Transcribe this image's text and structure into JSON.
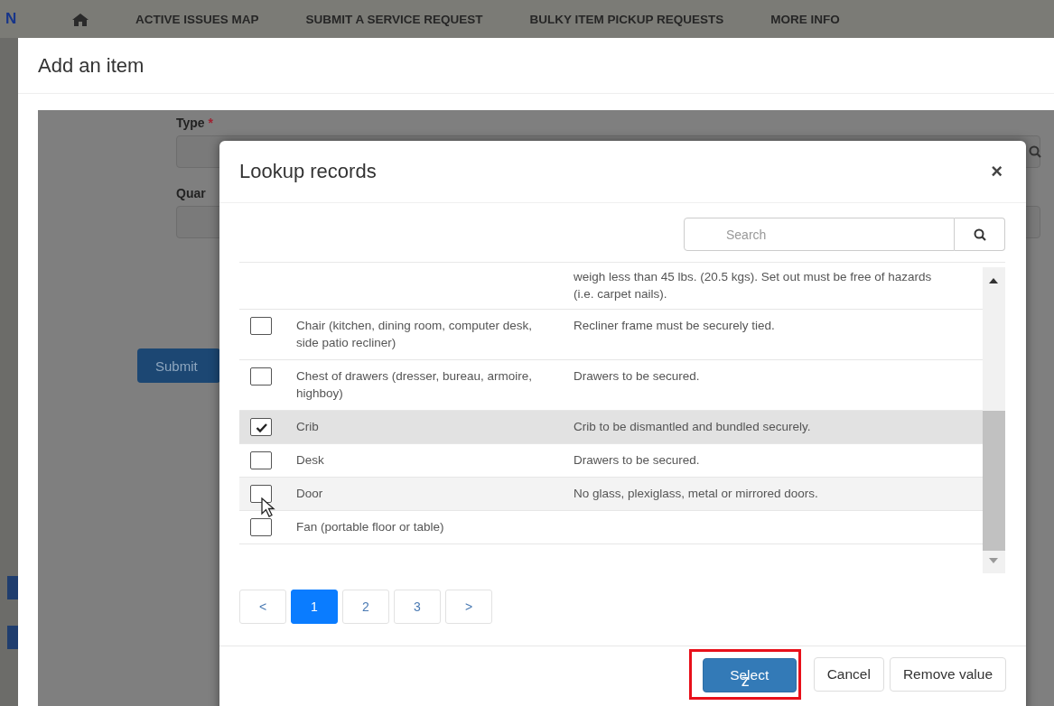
{
  "nav": {
    "edge_letter": "N",
    "items": [
      "ACTIVE ISSUES MAP",
      "SUBMIT A SERVICE REQUEST",
      "BULKY ITEM PICKUP REQUESTS",
      "MORE INFO"
    ]
  },
  "add_item_dialog": {
    "title": "Add an item",
    "fields": [
      {
        "label": "Type",
        "required": true,
        "required_mark": "*"
      },
      {
        "label": "Quar"
      }
    ],
    "submit_button": "Submit"
  },
  "lookup_dialog": {
    "title": "Lookup records",
    "close": "×",
    "search": {
      "placeholder": "Search"
    },
    "clipped_row_description": "weigh less than 45 lbs. (20.5 kgs). Set out must be free of hazards (i.e. carpet nails).",
    "rows": [
      {
        "name": "Chair (kitchen, dining room, computer desk, side patio recliner)",
        "description": "Recliner frame must be securely tied.",
        "checked": false,
        "selected": false,
        "hovered": false
      },
      {
        "name": "Chest of drawers (dresser, bureau, armoire, highboy)",
        "description": "Drawers to be secured.",
        "checked": false,
        "selected": false,
        "hovered": false
      },
      {
        "name": "Crib",
        "description": "Crib to be dismantled and bundled securely.",
        "checked": true,
        "selected": true,
        "hovered": false
      },
      {
        "name": "Desk",
        "description": "Drawers to be secured.",
        "checked": false,
        "selected": false,
        "hovered": false
      },
      {
        "name": "Door",
        "description": "No glass, plexiglass, metal or mirrored doors.",
        "checked": false,
        "selected": false,
        "hovered": true
      },
      {
        "name": "Fan (portable floor or table)",
        "checked": false,
        "selected": false,
        "hovered": false
      }
    ],
    "pagination": [
      {
        "label": "<",
        "selected": false
      },
      {
        "label": "1",
        "selected": true
      },
      {
        "label": "2",
        "selected": false
      },
      {
        "label": "3",
        "selected": false
      },
      {
        "label": ">",
        "selected": false
      }
    ],
    "buttons": [
      {
        "label": "Select",
        "kind": "primary",
        "highlighted": true
      },
      {
        "label": "Cancel",
        "kind": "default",
        "highlighted": false
      },
      {
        "label": "Remove value",
        "kind": "default",
        "highlighted": false
      }
    ],
    "annotation_mark": "z"
  }
}
